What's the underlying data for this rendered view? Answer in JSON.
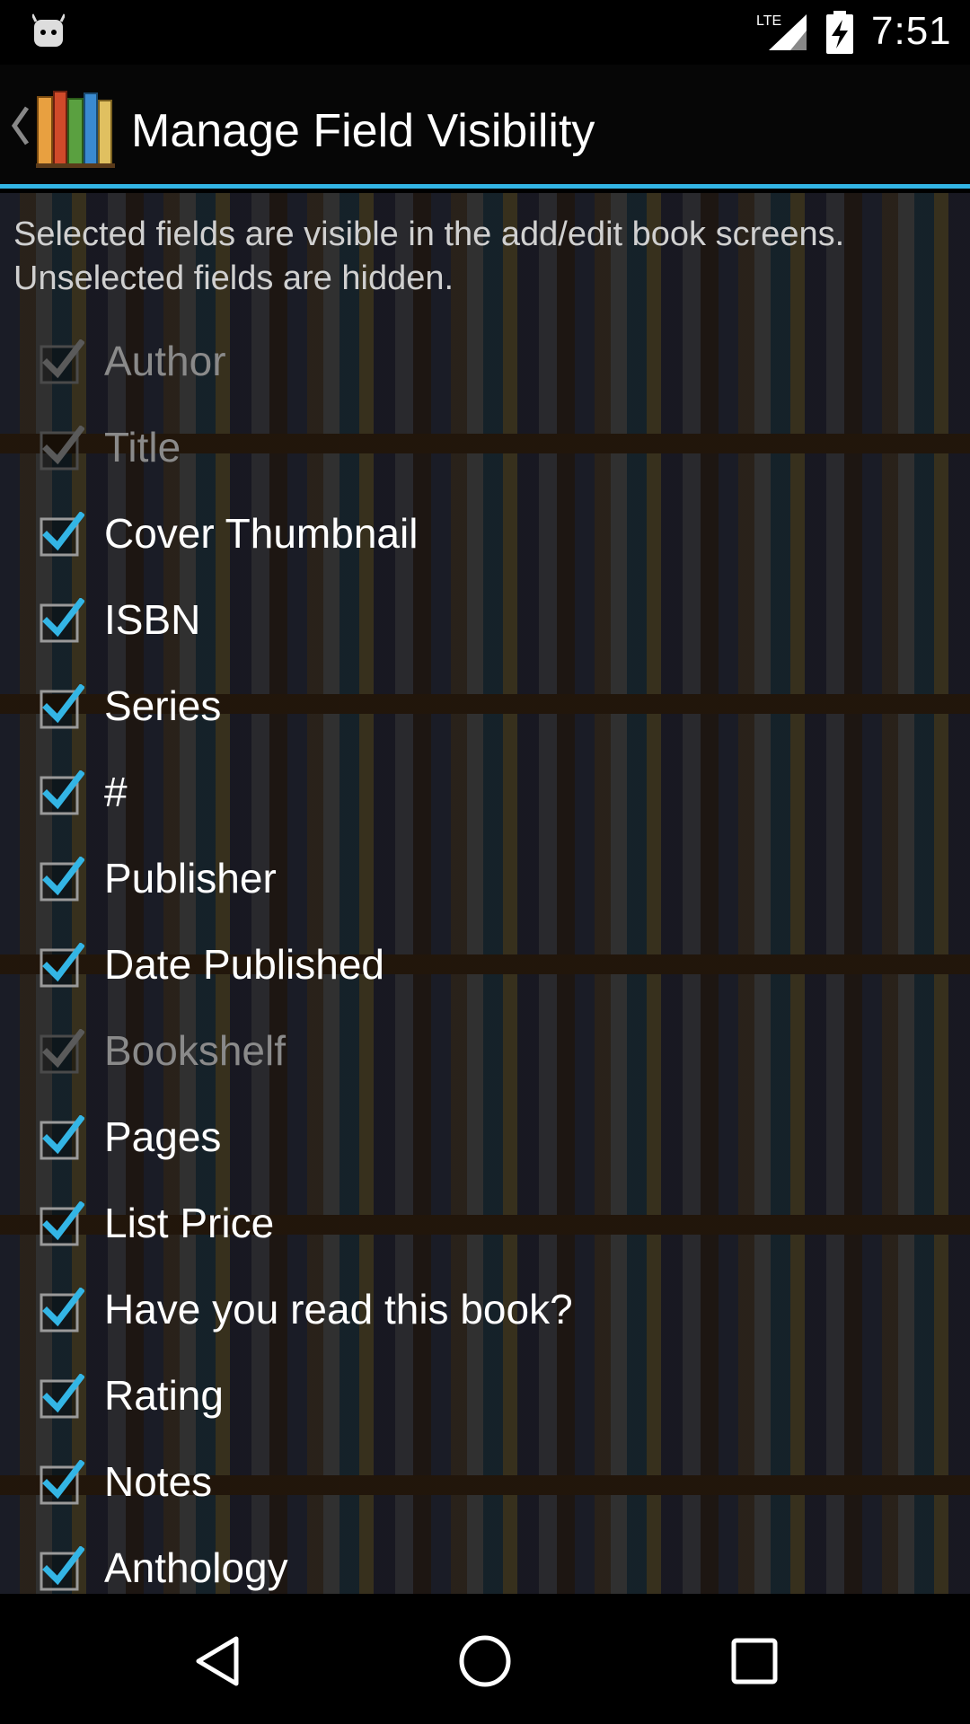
{
  "status_bar": {
    "network": "LTE",
    "time": "7:51",
    "left_icon": "android-robot-icon"
  },
  "action_bar": {
    "title": "Manage Field Visibility",
    "app_icon": "books-icon"
  },
  "description": "Selected fields are visible in the add/edit book screens. Unselected fields are hidden.",
  "fields": [
    {
      "label": "Author",
      "checked": true,
      "enabled": false
    },
    {
      "label": "Title",
      "checked": true,
      "enabled": false
    },
    {
      "label": "Cover Thumbnail",
      "checked": true,
      "enabled": true
    },
    {
      "label": "ISBN",
      "checked": true,
      "enabled": true
    },
    {
      "label": "Series",
      "checked": true,
      "enabled": true
    },
    {
      "label": "#",
      "checked": true,
      "enabled": true
    },
    {
      "label": "Publisher",
      "checked": true,
      "enabled": true
    },
    {
      "label": "Date Published",
      "checked": true,
      "enabled": true
    },
    {
      "label": "Bookshelf",
      "checked": true,
      "enabled": false
    },
    {
      "label": "Pages",
      "checked": true,
      "enabled": true
    },
    {
      "label": "List Price",
      "checked": true,
      "enabled": true
    },
    {
      "label": "Have you read this book?",
      "checked": true,
      "enabled": true
    },
    {
      "label": "Rating",
      "checked": true,
      "enabled": true
    },
    {
      "label": "Notes",
      "checked": true,
      "enabled": true
    },
    {
      "label": "Anthology",
      "checked": true,
      "enabled": true
    }
  ],
  "colors": {
    "accent": "#33b5e5",
    "check_enabled": "#33b5e5",
    "check_disabled": "#5a5a5a"
  },
  "nav_bar": {
    "back_icon": "back-triangle-icon",
    "home_icon": "home-circle-icon",
    "recents_icon": "recents-square-icon"
  }
}
